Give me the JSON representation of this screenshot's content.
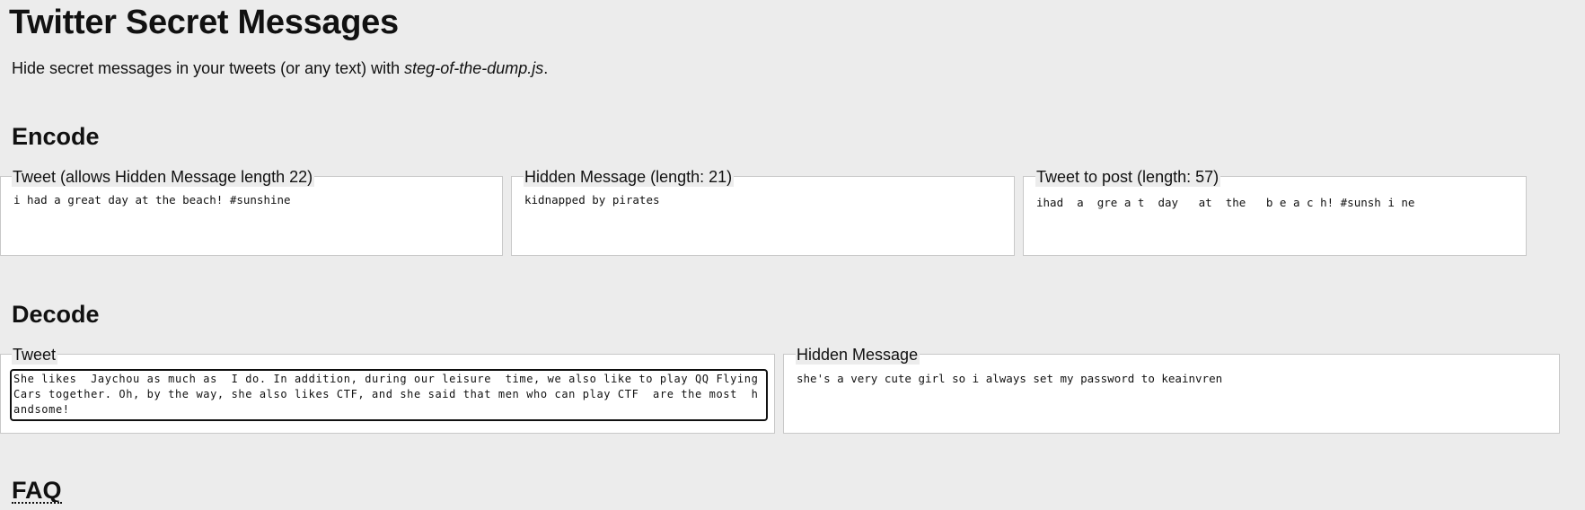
{
  "header": {
    "title": "Twitter Secret Messages",
    "subtitle_prefix": "Hide secret messages in your tweets (or any text) with ",
    "subtitle_link": "steg-of-the-dump.js",
    "subtitle_suffix": "."
  },
  "encode": {
    "heading": "Encode",
    "tweet": {
      "label": "Tweet (allows Hidden Message length 22)",
      "value": "i had a great day at the beach! #sunshine"
    },
    "hidden_message": {
      "label": "Hidden Message (length: 21)",
      "value": "kidnapped by pirates"
    },
    "tweet_to_post": {
      "label": "Tweet to post (length: 57)",
      "value": "ihad  a  gre a t  day   at  the   b e a c h! #sunsh i ne"
    }
  },
  "decode": {
    "heading": "Decode",
    "tweet": {
      "label": "Tweet",
      "value": "She likes  Jaychou as much as  I do. In addition, during our leisure  time, we also like to play QQ FlyingCars together. Oh, by the way, she also likes CTF, and she said that men who can play CTF  are the most  handsome!"
    },
    "hidden_message": {
      "label": "Hidden Message",
      "value": "she's a very cute girl so i always set my password to keainvren"
    }
  },
  "faq": {
    "heading": "FAQ"
  }
}
